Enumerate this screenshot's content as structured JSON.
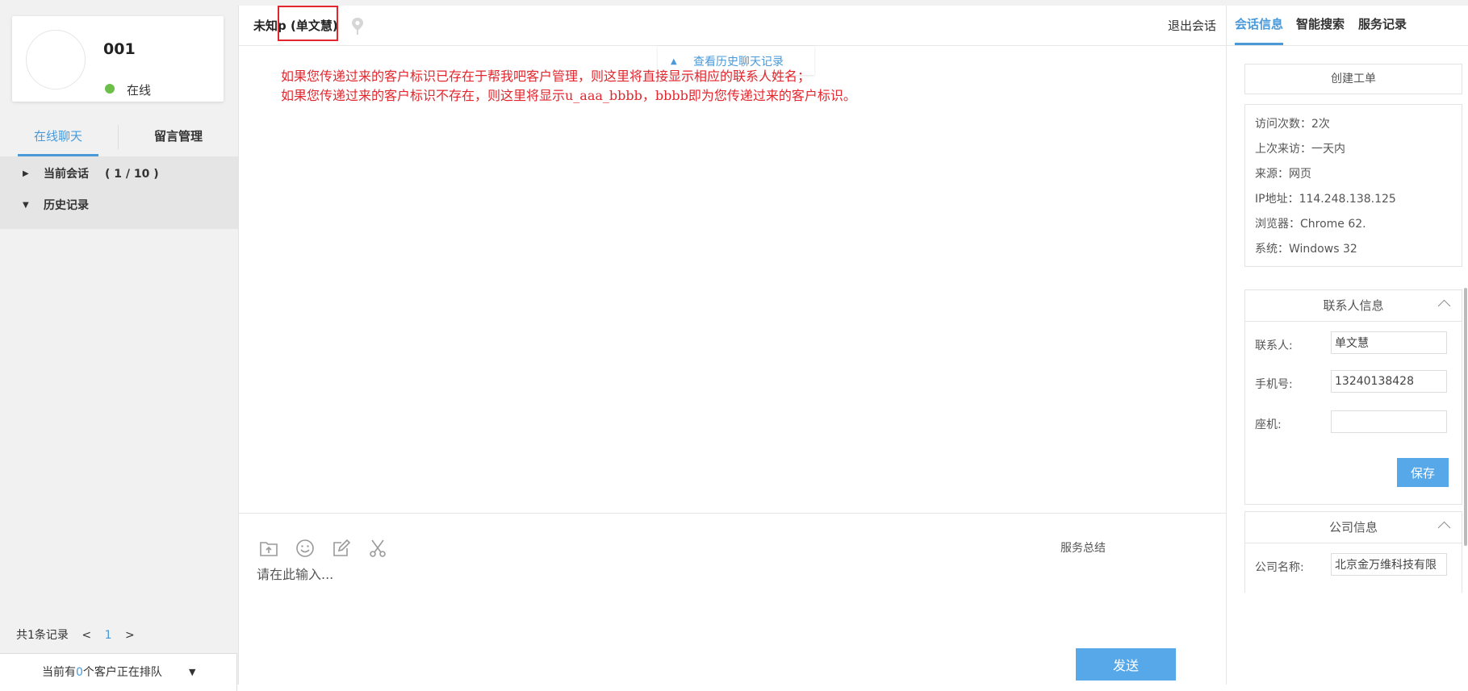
{
  "agent": {
    "id": "001",
    "status": "在线",
    "status_color": "#6cc04a"
  },
  "left_tabs": {
    "chat": "在线聊天",
    "messages": "留言管理"
  },
  "tree": {
    "current": {
      "label": "当前会话",
      "count": "( 1 / 10 )"
    },
    "history": {
      "label": "历史记录"
    }
  },
  "pager": {
    "total": "共1条记录",
    "prev": "<",
    "page": "1",
    "next": ">"
  },
  "queue": {
    "prefix": "当前有",
    "count": "0",
    "suffix": "个客户正在排队"
  },
  "chat": {
    "visitor_prefix": "未知",
    "visitor_name": "p (单文慧)",
    "exit_label": "退出会话",
    "history_link": "查看历史聊天记录",
    "note_line1": "如果您传递过来的客户标识已存在于帮我吧客户管理，则这里将直接显示相应的联系人姓名；",
    "note_line2": "如果您传递过来的客户标识不存在，则这里将显示u_aaa_bbbb，bbbb即为您传递过来的客户标识。",
    "summary_label": "服务总结",
    "input_placeholder": "请在此输入...",
    "send_label": "发送",
    "tools": [
      "upload-file-icon",
      "emoji-icon",
      "edit-icon",
      "screenshot-scissors-icon"
    ]
  },
  "right_tabs": {
    "session": "会话信息",
    "search": "智能搜索",
    "records": "服务记录"
  },
  "create_ticket": "创建工单",
  "visit_info": [
    "访问次数：2次",
    "上次来访：一天内",
    "来源：网页",
    "IP地址：114.248.138.125",
    "浏览器：Chrome 62.",
    "系统：Windows 32"
  ],
  "contact": {
    "title": "联系人信息",
    "name_label": "联系人:",
    "name_value": "单文慧",
    "phone_label": "手机号:",
    "phone_value": "13240138428",
    "landline_label": "座机:",
    "landline_value": "",
    "save_label": "保存"
  },
  "company": {
    "title": "公司信息",
    "name_label": "公司名称:",
    "name_value": "北京金万维科技有限"
  },
  "colors": {
    "accent": "#4a9ad9",
    "highlight": "#e3262d",
    "button": "#56a8e8"
  }
}
